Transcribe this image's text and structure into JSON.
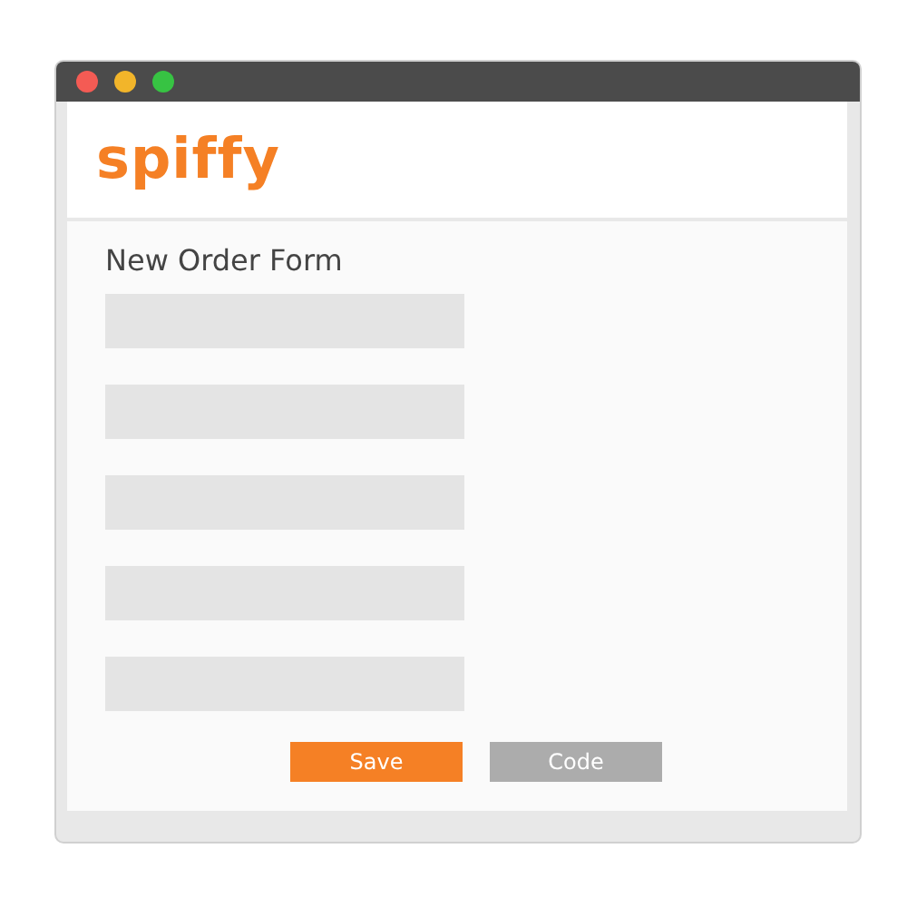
{
  "window": {
    "controls": [
      {
        "kind": "close"
      },
      {
        "kind": "minimize"
      },
      {
        "kind": "maximize"
      }
    ]
  },
  "header": {
    "logo": "spiffy"
  },
  "form": {
    "title": "New Order Form",
    "fields": [
      {
        "kind": "text"
      },
      {
        "kind": "text"
      },
      {
        "kind": "text"
      },
      {
        "kind": "text"
      },
      {
        "kind": "text"
      }
    ],
    "buttons": [
      {
        "label": "Save",
        "kind": "primary"
      },
      {
        "label": "Code",
        "kind": "secondary"
      }
    ]
  }
}
